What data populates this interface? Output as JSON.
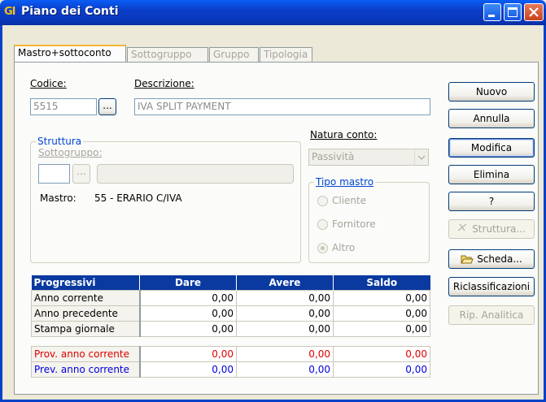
{
  "window": {
    "app_icon": "GI",
    "title": "Piano dei Conti"
  },
  "tabs": [
    {
      "label": "Mastro+sottoconto",
      "active": true
    },
    {
      "label": "Sottogruppo",
      "active": false
    },
    {
      "label": "Gruppo",
      "active": false
    },
    {
      "label": "Tipologia",
      "active": false
    }
  ],
  "form": {
    "codice_label": "Codice:",
    "codice_value": "5515",
    "lookup_label": "...",
    "descrizione_label": "Descrizione:",
    "descrizione_value": "IVA SPLIT PAYMENT",
    "struttura": {
      "title": "Struttura",
      "sottogruppo_label": "Sottogruppo:",
      "sottogruppo_lookup": "...",
      "mastro_label": "Mastro:",
      "mastro_value": "55 - ERARIO C/IVA"
    },
    "natura_conto": {
      "label": "Natura conto:",
      "value": "Passività"
    },
    "tipo_mastro": {
      "title": "Tipo mastro",
      "options": [
        {
          "label": "Cliente",
          "checked": false
        },
        {
          "label": "Fornitore",
          "checked": false
        },
        {
          "label": "Altro",
          "checked": true
        }
      ]
    }
  },
  "buttons": {
    "nuovo": "Nuovo",
    "annulla": "Annulla",
    "modifica": "Modifica",
    "elimina": "Elimina",
    "help": "?",
    "struttura": "Struttura...",
    "scheda": "Scheda...",
    "riclassificazioni": "Riclassificazioni",
    "rip_analitica": "Rip. Analitica"
  },
  "grid": {
    "headers": [
      "Progressivi",
      "Dare",
      "Avere",
      "Saldo"
    ],
    "rows": [
      {
        "label": "Anno corrente",
        "dare": "0,00",
        "avere": "0,00",
        "saldo": "0,00",
        "color": "black"
      },
      {
        "label": "Anno precedente",
        "dare": "0,00",
        "avere": "0,00",
        "saldo": "0,00",
        "color": "black"
      },
      {
        "label": "Stampa giornale",
        "dare": "0,00",
        "avere": "0,00",
        "saldo": "0,00",
        "color": "black"
      },
      {
        "label": "Prov. anno corrente",
        "dare": "0,00",
        "avere": "0,00",
        "saldo": "0,00",
        "color": "red"
      },
      {
        "label": "Prev. anno corrente",
        "dare": "0,00",
        "avere": "0,00",
        "saldo": "0,00",
        "color": "blue"
      }
    ]
  },
  "colors": {
    "titlebar": "#0A3EC8",
    "grid_header": "#0A3AA0",
    "prov_row": "#E00000",
    "prev_row": "#0000E0"
  }
}
